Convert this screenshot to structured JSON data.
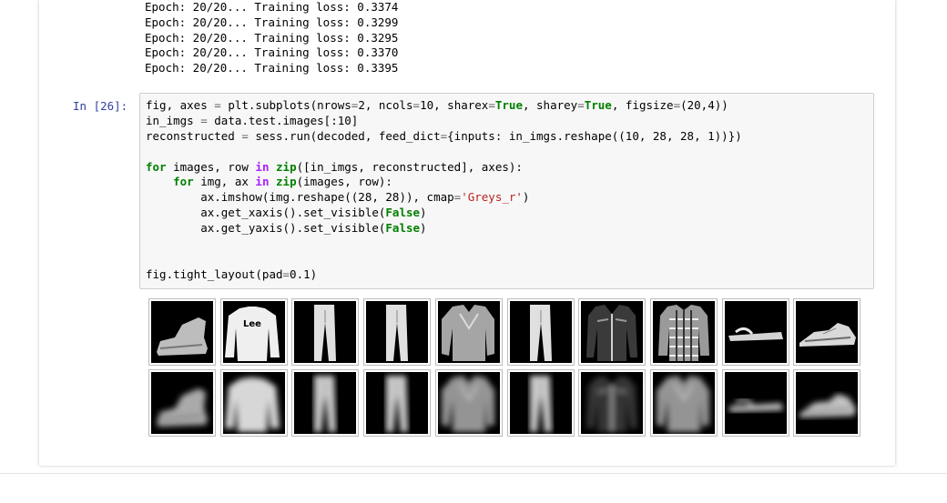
{
  "output": {
    "lines": [
      "Epoch: 20/20... Training loss: 0.3374",
      "Epoch: 20/20... Training loss: 0.3299",
      "Epoch: 20/20... Training loss: 0.3295",
      "Epoch: 20/20... Training loss: 0.3370",
      "Epoch: 20/20... Training loss: 0.3395"
    ]
  },
  "cell": {
    "prompt": "In [26]:",
    "code": {
      "l1_a": "fig, axes ",
      "l1_eq": "=",
      "l1_b": " plt.subplots(nrows",
      "l1_eq2": "=",
      "l1_c": "2, ncols",
      "l1_eq3": "=",
      "l1_d": "10, sharex",
      "l1_eq4": "=",
      "l1_true1": "True",
      "l1_e": ", sharey",
      "l1_eq5": "=",
      "l1_true2": "True",
      "l1_f": ", figsize",
      "l1_eq6": "=",
      "l1_g": "(20,4))",
      "l2_a": "in_imgs ",
      "l2_eq": "=",
      "l2_b": " data.test.images[:10]",
      "l3_a": "reconstructed ",
      "l3_eq": "=",
      "l3_b": " sess.run(decoded, feed_dict",
      "l3_eq2": "=",
      "l3_c": "{inputs: in_imgs.reshape((10, 28, 28, 1))})",
      "l5_for": "for",
      "l5_a": " images, row ",
      "l5_in": "in",
      "l5_sp": " ",
      "l5_zip": "zip",
      "l5_b": "([in_imgs, reconstructed], axes):",
      "l6_indent": "    ",
      "l6_for": "for",
      "l6_a": " img, ax ",
      "l6_in": "in",
      "l6_sp": " ",
      "l6_zip": "zip",
      "l6_b": "(images, row):",
      "l7_a": "        ax.imshow(img.reshape((28, 28)), cmap",
      "l7_eq": "=",
      "l7_str": "'Greys_r'",
      "l7_b": ")",
      "l8_a": "        ax.get_xaxis().set_visible(",
      "l8_false": "False",
      "l8_b": ")",
      "l9_a": "        ax.get_yaxis().set_visible(",
      "l9_false": "False",
      "l9_b": ")",
      "l12_a": "fig.tight_layout(pad",
      "l12_eq": "=",
      "l12_b": "0.1)"
    }
  },
  "figure": {
    "rows": [
      {
        "name": "input-images",
        "items": [
          "ankle-boot",
          "pullover",
          "trouser",
          "trouser",
          "shirt",
          "trouser",
          "coat",
          "shirt-plaid",
          "sandal",
          "sneaker"
        ],
        "shirt_logo_text": "Lee"
      },
      {
        "name": "reconstructed-images",
        "items": [
          "ankle-boot-blurred",
          "pullover-blurred",
          "trouser-blurred",
          "trouser-blurred",
          "shirt-blurred",
          "trouser-blurred",
          "coat-blurred",
          "shirt-blurred",
          "sandal-blurred",
          "sneaker-blurred"
        ]
      }
    ],
    "colormap": "Greys_r"
  }
}
